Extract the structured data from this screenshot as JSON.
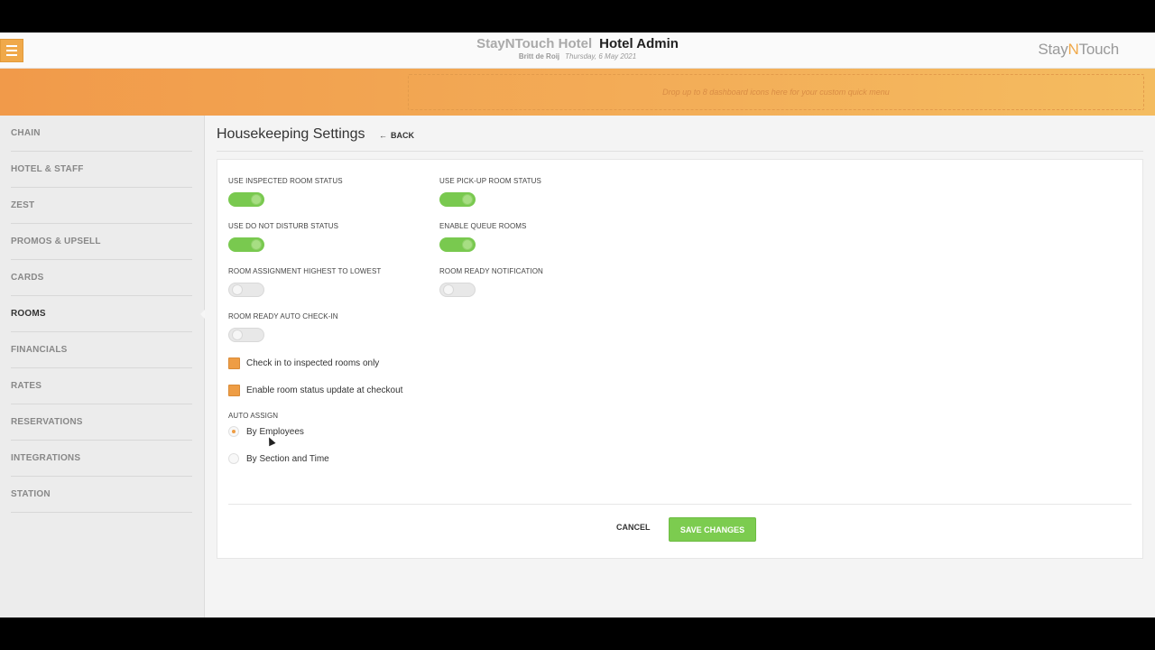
{
  "header": {
    "hotel_name": "StayNTouch Hotel",
    "section_title": "Hotel Admin",
    "user": "Britt de Roij",
    "date": "Thursday, 6 May 2021",
    "brand": {
      "prefix": "Stay",
      "accent": "N",
      "suffix": "Touch"
    }
  },
  "dashboard": {
    "drop_zone_text": "Drop up to 8 dashboard icons here for your custom quick menu"
  },
  "sidebar": {
    "items": [
      {
        "label": "CHAIN"
      },
      {
        "label": "HOTEL & STAFF"
      },
      {
        "label": "ZEST"
      },
      {
        "label": "PROMOS & UPSELL"
      },
      {
        "label": "CARDS"
      },
      {
        "label": "ROOMS",
        "active": true
      },
      {
        "label": "FINANCIALS"
      },
      {
        "label": "RATES"
      },
      {
        "label": "RESERVATIONS"
      },
      {
        "label": "INTEGRATIONS"
      },
      {
        "label": "STATION"
      }
    ]
  },
  "page": {
    "title": "Housekeeping Settings",
    "back_label": "BACK"
  },
  "settings": {
    "inspected_room_status": {
      "label": "USE INSPECTED ROOM STATUS",
      "value": true
    },
    "pickup_room_status": {
      "label": "USE PICK-UP ROOM STATUS",
      "value": true
    },
    "do_not_disturb_status": {
      "label": "USE DO NOT DISTURB STATUS",
      "value": true
    },
    "queue_rooms": {
      "label": "ENABLE QUEUE ROOMS",
      "value": true
    },
    "assignment_high_low": {
      "label": "ROOM ASSIGNMENT HIGHEST TO LOWEST",
      "value": false
    },
    "room_ready_notification": {
      "label": "ROOM READY NOTIFICATION",
      "value": false
    },
    "room_ready_auto_checkin": {
      "label": "ROOM READY AUTO CHECK-IN",
      "value": false
    },
    "checkin_inspected_only": {
      "label": "Check in to inspected rooms only",
      "checked": true
    },
    "status_update_checkout": {
      "label": "Enable room status update at checkout",
      "checked": true
    },
    "auto_assign": {
      "label": "AUTO ASSIGN",
      "options": [
        {
          "label": "By Employees",
          "selected": true
        },
        {
          "label": "By Section and Time",
          "selected": false
        }
      ]
    }
  },
  "actions": {
    "cancel_label": "CANCEL",
    "save_label": "SAVE CHANGES"
  },
  "colors": {
    "accent_orange": "#f0a94a",
    "toggle_on_green": "#79c94f",
    "save_green": "#7ccc4f"
  }
}
